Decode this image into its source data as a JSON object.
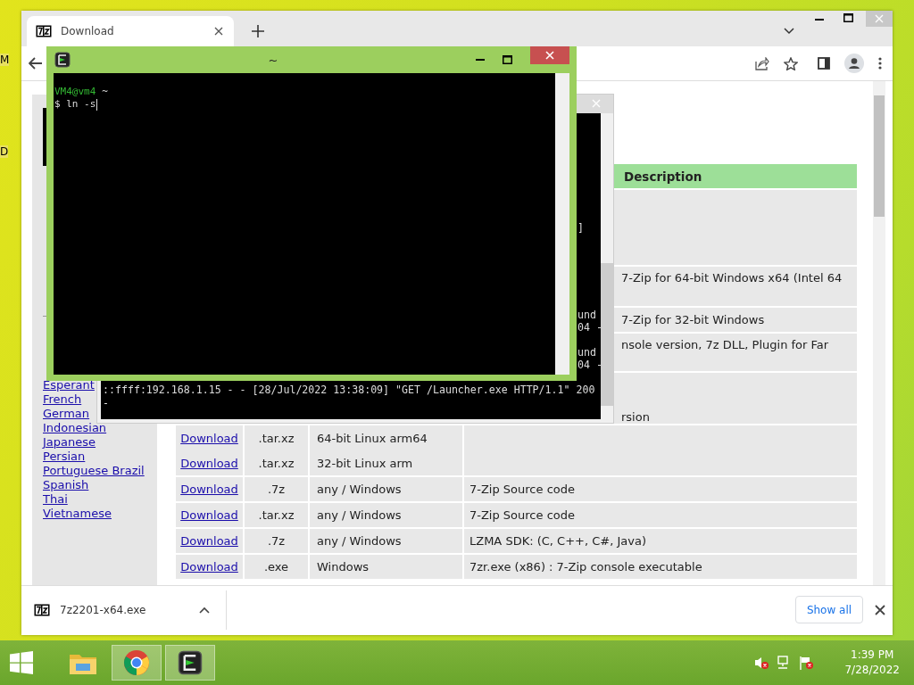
{
  "desktop": {
    "icon_labels": [
      "M",
      "D"
    ]
  },
  "browser": {
    "tabs": [
      {
        "title": "Download",
        "selected": true
      }
    ],
    "sidebar": {
      "languages": [
        "Esperant",
        "French",
        "German",
        "Indonesian",
        "Japanese",
        "Persian",
        "Portuguese Brazil",
        "Spanish",
        "Thai",
        "Vietnamese"
      ]
    },
    "table": {
      "header": "Description",
      "rows": [
        {
          "kind": "covered"
        },
        {
          "kind": "covered",
          "description": "7-Zip for 64-bit Windows x64 (Intel 64"
        },
        {
          "kind": "covered",
          "description": "7-Zip for 32-bit Windows"
        },
        {
          "kind": "covered",
          "description": "nsole version, 7z DLL, Plugin for Far"
        },
        {
          "kind": "covered",
          "description": "rsion"
        },
        {
          "kind": "full",
          "link": "Download",
          "type": ".tar.xz",
          "platform": "64-bit Linux arm64"
        },
        {
          "kind": "full",
          "link": "Download",
          "type": ".tar.xz",
          "platform": "32-bit Linux arm"
        },
        {
          "kind": "full",
          "link": "Download",
          "type": ".7z",
          "platform": "any / Windows",
          "description": "7-Zip Source code"
        },
        {
          "kind": "full",
          "link": "Download",
          "type": ".tar.xz",
          "platform": "any / Windows",
          "description": "7-Zip Source code"
        },
        {
          "kind": "full",
          "link": "Download",
          "type": ".7z",
          "platform": "any / Windows",
          "description": "LZMA SDK: (C, C++, C#, Java)"
        },
        {
          "kind": "full",
          "link": "Download",
          "type": ".exe",
          "platform": "Windows",
          "description": "7zr.exe (x86) : 7-Zip console executable"
        }
      ]
    },
    "download_bar": {
      "file": "7z2201-x64.exe",
      "show_all": "Show all"
    }
  },
  "back_terminal": {
    "fragments": [
      "]",
      "und",
      "04 -",
      "und",
      "04 -"
    ],
    "log_lines": [
      "::ffff:192.168.1.15 - - [28/Jul/2022 13:38:09] \"GET /Launcher.exe HTTP/1.1\" 200",
      "-"
    ]
  },
  "front_terminal": {
    "title": "~",
    "user": "VM4@vm4",
    "path": "~",
    "command": "$ ln -s"
  },
  "taskbar": {
    "apps": [
      {
        "kind": "explorer",
        "selected": false
      },
      {
        "kind": "chrome",
        "selected": true
      },
      {
        "kind": "terminal",
        "selected": true
      }
    ],
    "time": "1:39 PM",
    "date": "7/28/2022"
  }
}
